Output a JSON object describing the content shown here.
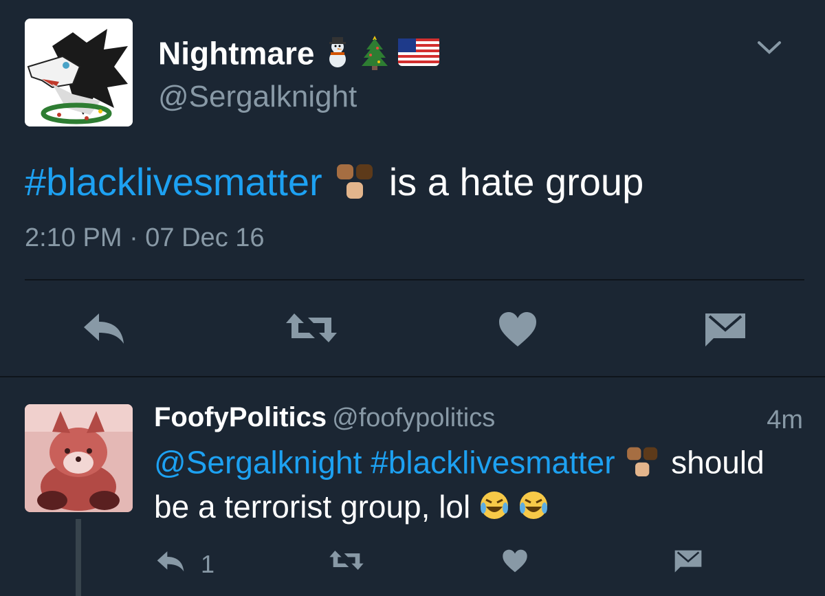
{
  "tweet": {
    "display_name": "Nightmare",
    "name_emojis": [
      "snowman-emoji",
      "christmas-tree-emoji",
      "us-flag-emoji"
    ],
    "handle": "@Sergalknight",
    "hashtag": "#blacklivesmatter",
    "text_rest": "is a hate group",
    "timestamp": "2:10 PM · 07 Dec 16",
    "actions": [
      "reply-icon",
      "retweet-icon",
      "heart-icon",
      "dm-icon"
    ]
  },
  "reply": {
    "display_name": "FoofyPolitics",
    "handle": "@foofypolitics",
    "time": "4m",
    "mention": "@Sergalknight",
    "hashtag": "#blacklivesmatter",
    "text_line1_end": "should",
    "text_line2": "be a terrorist group, lol",
    "reply_count": "1"
  },
  "colors": {
    "background": "#1b2633",
    "link": "#1da1f2",
    "muted": "#8899a6",
    "icon": "#8899a6"
  }
}
